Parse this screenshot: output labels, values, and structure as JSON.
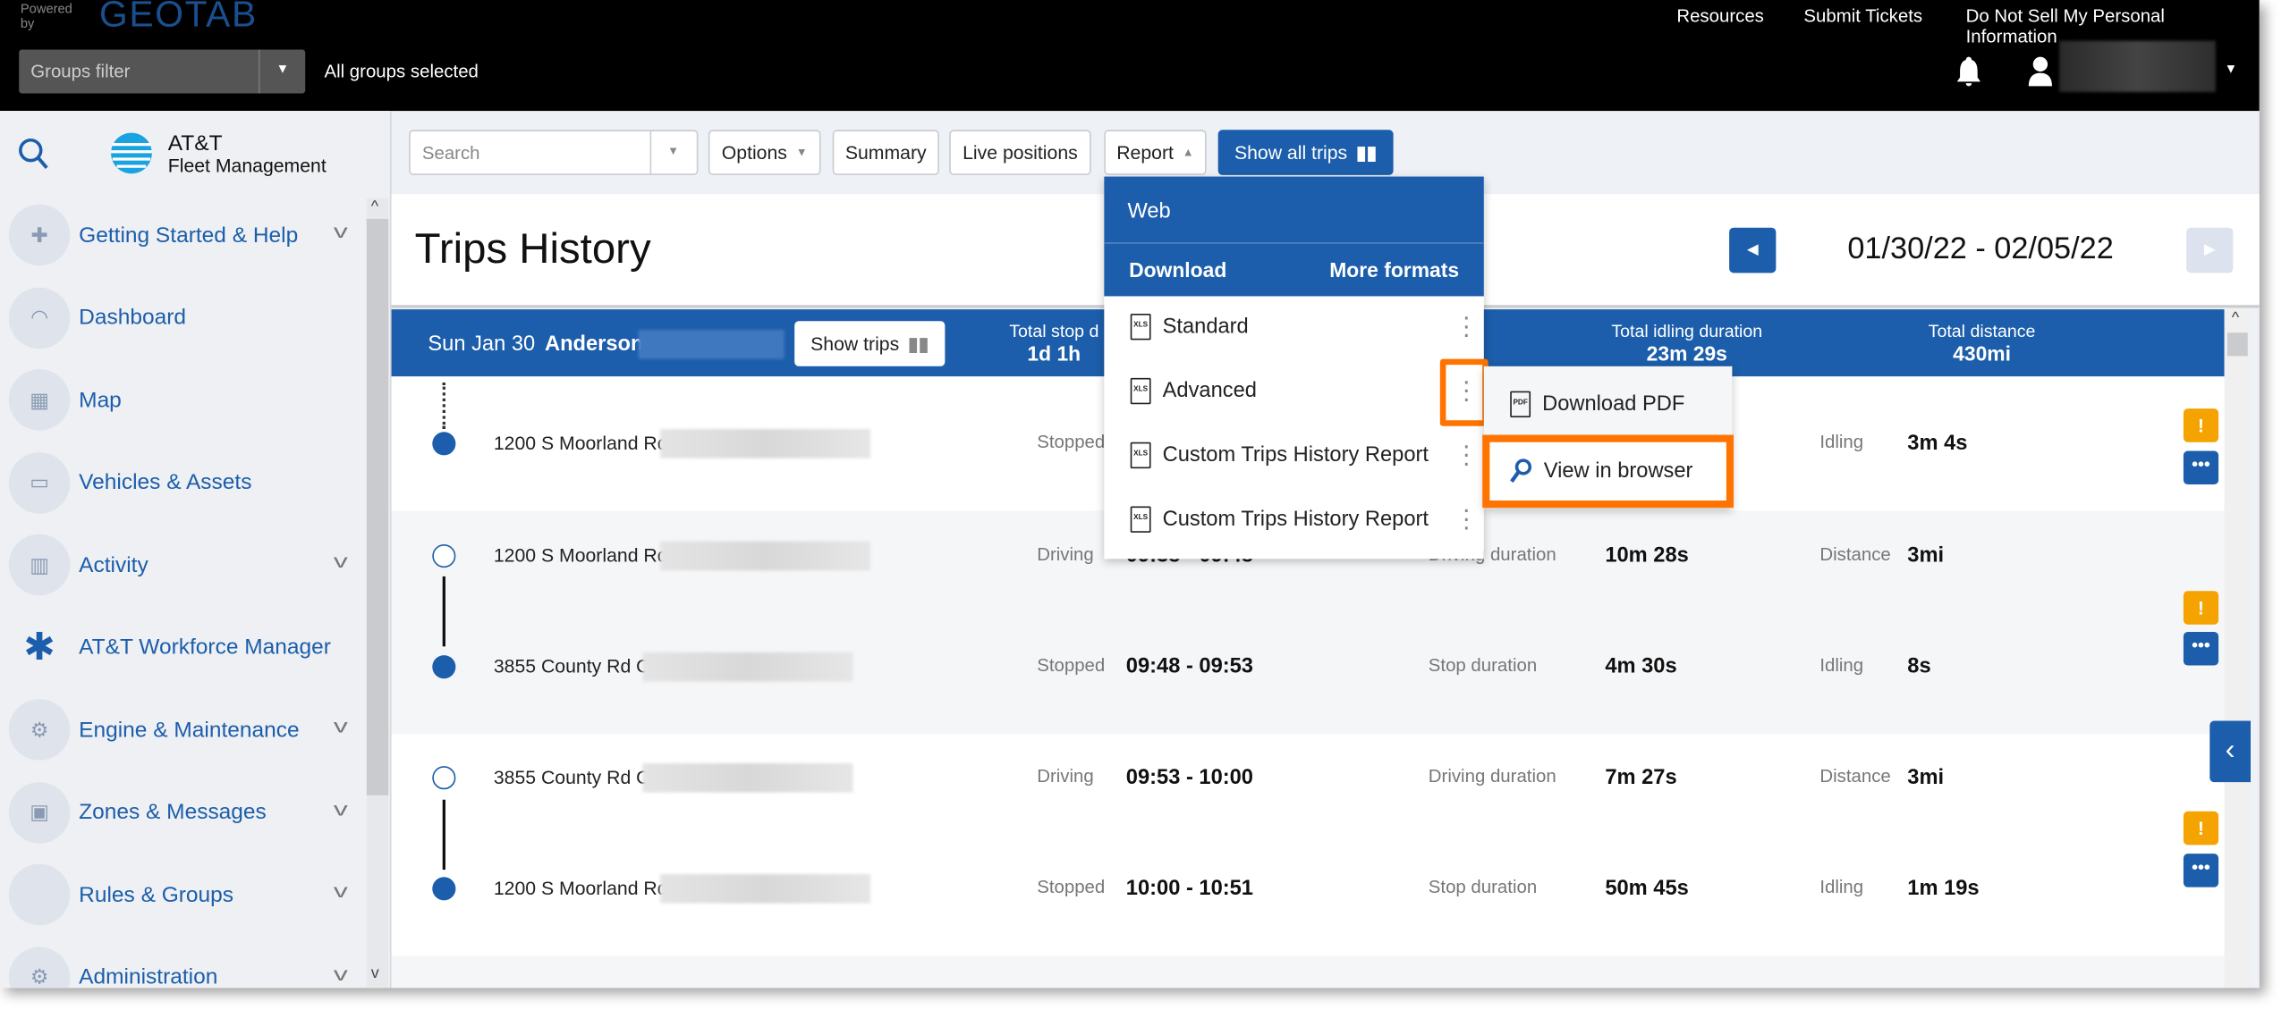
{
  "topbar": {
    "powered_by": "Powered by",
    "brand": "GEOTAB",
    "groups_filter_placeholder": "Groups filter",
    "groups_status": "All groups selected",
    "links": [
      "Resources",
      "Submit Tickets",
      "Do Not Sell My Personal Information"
    ]
  },
  "sidebar": {
    "logo_line1": "AT&T",
    "logo_line2": "Fleet Management",
    "items": [
      {
        "label": "Getting Started & Help",
        "icon": "first-aid-icon",
        "expandable": true
      },
      {
        "label": "Dashboard",
        "icon": "gauge-icon",
        "expandable": false
      },
      {
        "label": "Map",
        "icon": "map-icon",
        "expandable": false
      },
      {
        "label": "Vehicles & Assets",
        "icon": "car-icon",
        "expandable": false
      },
      {
        "label": "Activity",
        "icon": "bar-chart-icon",
        "expandable": true
      },
      {
        "label": "AT&T Workforce Manager",
        "icon": "puzzle-icon",
        "expandable": false
      },
      {
        "label": "Engine & Maintenance",
        "icon": "engine-icon",
        "expandable": true
      },
      {
        "label": "Zones & Messages",
        "icon": "zone-icon",
        "expandable": true
      },
      {
        "label": "Rules & Groups",
        "icon": "rules-icon",
        "expandable": true
      },
      {
        "label": "Administration",
        "icon": "gear-icon",
        "expandable": true
      }
    ]
  },
  "toolbar": {
    "search_placeholder": "Search",
    "options": "Options",
    "summary": "Summary",
    "live_positions": "Live positions",
    "report": "Report",
    "show_all_trips": "Show all trips"
  },
  "page": {
    "title": "Trips History",
    "date_range": "01/30/22 - 02/05/22"
  },
  "day": {
    "date": "Sun Jan 30",
    "driver": "Anderson",
    "show_trips": "Show trips",
    "totals": [
      {
        "label": "Total stop d",
        "value": "1d 1h"
      },
      {
        "label": "Total idling duration",
        "value": "23m 29s"
      },
      {
        "label": "Total distance",
        "value": "430mi"
      }
    ]
  },
  "entries": [
    {
      "address": "1200 S Moorland Rd,",
      "status": "Stopped",
      "time": "",
      "dur_label": "",
      "dur_value": "",
      "label2": "Idling",
      "value2": "3m 4s",
      "filled": true
    },
    {
      "address": "1200 S Moorland Rd,",
      "status": "Driving",
      "time": "09:38 - 09:48",
      "dur_label": "Driving duration",
      "dur_value": "10m 28s",
      "label2": "Distance",
      "value2": "3mi",
      "filled": false
    },
    {
      "address": "3855 County Rd O,",
      "status": "Stopped",
      "time": "09:48 - 09:53",
      "dur_label": "Stop duration",
      "dur_value": "4m 30s",
      "label2": "Idling",
      "value2": "8s",
      "filled": true
    },
    {
      "address": "3855 County Rd O,",
      "status": "Driving",
      "time": "09:53 - 10:00",
      "dur_label": "Driving duration",
      "dur_value": "7m 27s",
      "label2": "Distance",
      "value2": "3mi",
      "filled": false
    },
    {
      "address": "1200 S Moorland Rd,",
      "status": "Stopped",
      "time": "10:00 - 10:51",
      "dur_label": "Stop duration",
      "dur_value": "50m 45s",
      "label2": "Idling",
      "value2": "1m 19s",
      "filled": true
    }
  ],
  "report_menu": {
    "web": "Web",
    "download": "Download",
    "more_formats": "More formats",
    "items": [
      "Standard",
      "Advanced",
      "Custom Trips History Report",
      "Custom Trips History Report"
    ],
    "file_badge": "XLS"
  },
  "submenu": {
    "download_pdf": "Download PDF",
    "pdf_badge": "PDF",
    "view_in_browser": "View in browser"
  },
  "colors": {
    "brand_blue": "#1c5eab",
    "highlight": "#ff7300",
    "warning": "#f5a300"
  }
}
